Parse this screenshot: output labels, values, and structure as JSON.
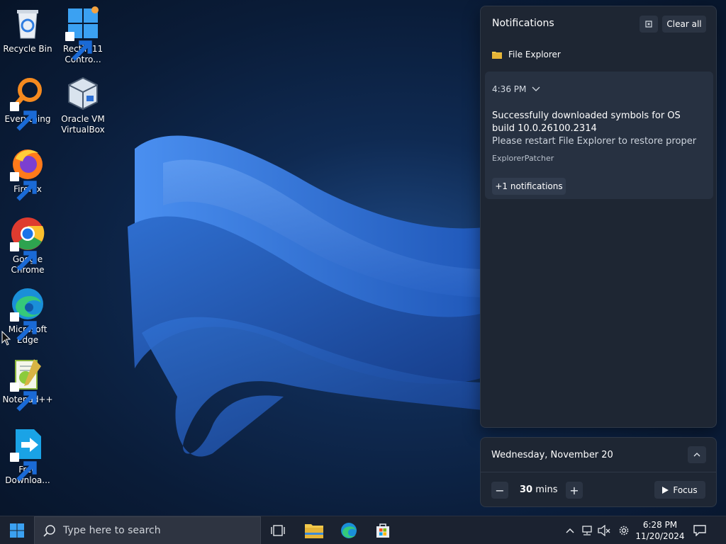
{
  "desktop": {
    "icons": [
      {
        "label": "Recycle Bin"
      },
      {
        "label": "Rectify11\nContro..."
      },
      {
        "label": "Everything"
      },
      {
        "label": "Oracle VM\nVirtualBox"
      },
      {
        "label": "Firefox"
      },
      {
        "label": "Google\nChrome"
      },
      {
        "label": "Microsoft\nEdge"
      },
      {
        "label": "Notepad++"
      },
      {
        "label": "Free\nDownloa..."
      }
    ]
  },
  "notifications": {
    "title": "Notifications",
    "clear_all": "Clear all",
    "app_name": "File Explorer",
    "card": {
      "time": "4:36 PM",
      "heading": "Successfully downloaded symbols for OS build 10.0.26100.2314",
      "body": "Please restart File Explorer to restore proper",
      "source": "ExplorerPatcher",
      "more": "+1 notifications"
    }
  },
  "calendar": {
    "date": "Wednesday, November 20",
    "focus_minutes": "30",
    "focus_unit": "mins",
    "minus": "−",
    "plus": "+",
    "focus_label": "Focus"
  },
  "taskbar": {
    "search_placeholder": "Type here to search",
    "time": "6:28 PM",
    "date": "11/20/2024"
  },
  "colors": {
    "accent": "#3b8ad9",
    "panel_bg": "#1e2633",
    "taskbar_bg": "#1b2230"
  }
}
